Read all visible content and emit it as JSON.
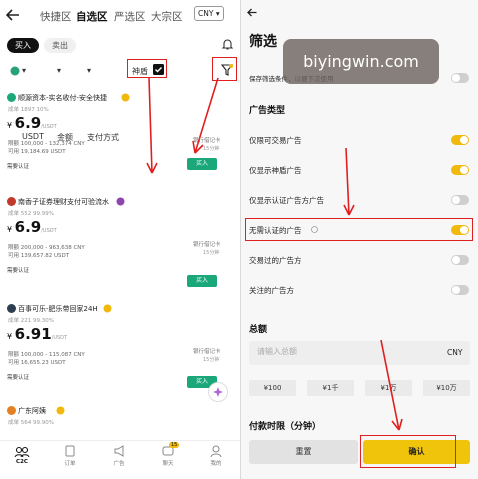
{
  "left": {
    "tabs": [
      {
        "label": "快捷区",
        "active": false
      },
      {
        "label": "自选区",
        "active": true
      },
      {
        "label": "严选区",
        "active": false
      },
      {
        "label": "大宗区",
        "active": false
      }
    ],
    "currency": "CNY",
    "buy_tab": "买入",
    "sell_tab": "卖出",
    "filters": {
      "coin": "USDT",
      "amount": "金额",
      "payment": "支付方式",
      "shield": "神盾"
    },
    "cards": [
      {
        "merchant": "顺源资本-实名收付-安全快捷",
        "stats": "成单 1897  10%",
        "price": "6.9",
        "unit": "/USDT",
        "limit": "限额 100,000 - 132,374 CNY",
        "available": "可用 19,184.69 USDT",
        "badge": "需要认证",
        "payment": "银行借记卡",
        "time": "15分钟",
        "buy": "买入"
      },
      {
        "merchant": "南香子证券理财支付可验流水",
        "stats": "成单 552  99.99%",
        "price": "6.9",
        "unit": "/USDT",
        "limit": "限额 200,000 - 963,638 CNY",
        "available": "可用 139,657.82 USDT",
        "badge": "需要认证",
        "payment": "银行借记卡",
        "time": "15分钟",
        "buy": "买入"
      },
      {
        "merchant": "百事可乐-肥乐带回家24H",
        "stats": "成单 221  99.30%",
        "price": "6.91",
        "unit": "/USDT",
        "limit": "限额 100,000 - 115,087 CNY",
        "available": "可用 16,655.23 USDT",
        "badge": "需要认证",
        "payment": "银行借记卡",
        "time": "15分钟",
        "buy": "买入"
      },
      {
        "merchant": "广东阿姨",
        "stats": "成单 564  99.90%"
      }
    ],
    "nav": [
      {
        "label": "C2C",
        "icon": "c2c-icon"
      },
      {
        "label": "订单",
        "icon": "orders-icon"
      },
      {
        "label": "广告",
        "icon": "ads-icon"
      },
      {
        "label": "聊天",
        "icon": "chat-icon",
        "badge": "15"
      },
      {
        "label": "我的",
        "icon": "profile-icon"
      }
    ]
  },
  "right": {
    "title": "筛选",
    "save_filter": "保存筛选条件，以便下次使用",
    "ad_type_title": "广告类型",
    "options": [
      {
        "label": "仅限可交易广告",
        "on": true
      },
      {
        "label": "仅显示神盾广告",
        "on": true
      },
      {
        "label": "仅显示认证广告方广告",
        "on": false
      },
      {
        "label": "无需认证的广告",
        "on": true
      },
      {
        "label": "交易过的广告方",
        "on": false
      },
      {
        "label": "关注的广告方",
        "on": false
      }
    ],
    "amount_title": "总额",
    "amount_placeholder": "请输入总额",
    "amount_currency": "CNY",
    "quick_amounts": [
      "¥100",
      "¥1千",
      "¥1万",
      "¥10万"
    ],
    "time_title": "付款时限（分钟）",
    "reset": "重置",
    "confirm": "确认"
  },
  "watermark": "biyingwin.com",
  "colors": {
    "accent": "#f0b90b",
    "buy": "#1aa87a",
    "annotation": "#e02020"
  }
}
